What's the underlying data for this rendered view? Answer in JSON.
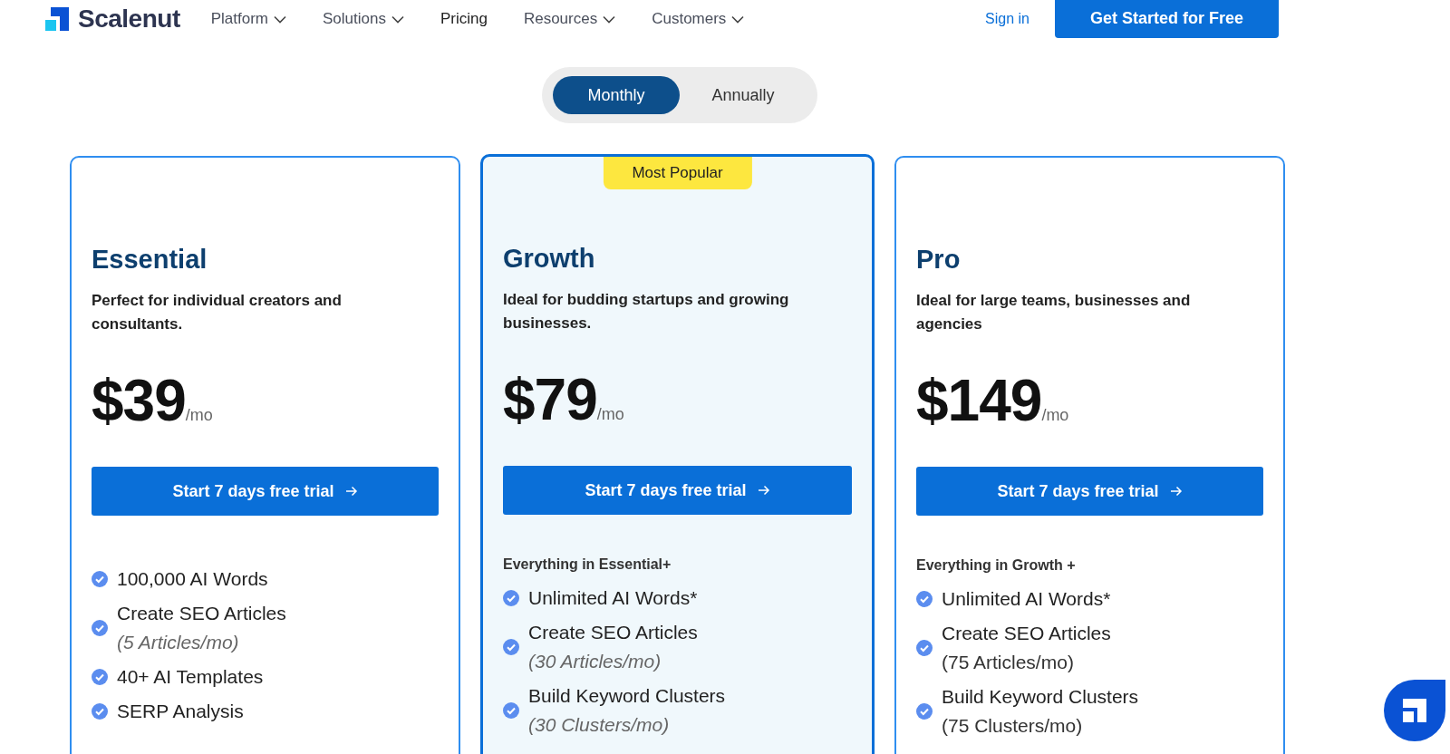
{
  "header": {
    "brand": "Scalenut",
    "nav": [
      {
        "label": "Platform",
        "dropdown": true
      },
      {
        "label": "Solutions",
        "dropdown": true
      },
      {
        "label": "Pricing",
        "dropdown": false
      },
      {
        "label": "Resources",
        "dropdown": true
      },
      {
        "label": "Customers",
        "dropdown": true
      }
    ],
    "sign_in": "Sign in",
    "cta": "Get Started for Free"
  },
  "billing_toggle": [
    {
      "label": "Monthly",
      "selected": true
    },
    {
      "label": "Annually",
      "selected": false
    }
  ],
  "plans": [
    {
      "name": "Essential",
      "featured": false,
      "description": "Perfect for individual creators and consultants.",
      "price": "$39",
      "period": "/mo",
      "button": "Start 7 days free trial",
      "notes_italic": true,
      "features": [
        {
          "text": "100,000 AI Words"
        },
        {
          "text": "Create SEO Articles",
          "note": "(5 Articles/mo)"
        },
        {
          "text": "40+ AI Templates"
        },
        {
          "text": "SERP Analysis"
        }
      ]
    },
    {
      "name": "Growth",
      "featured": true,
      "badge": "Most Popular",
      "description": "Ideal for budding startups and growing businesses.",
      "price": "$79",
      "period": "/mo",
      "button": "Start 7 days free trial",
      "intro": "Everything in Essential+",
      "notes_italic": true,
      "features": [
        {
          "text": "Unlimited AI Words*"
        },
        {
          "text": "Create SEO Articles",
          "note": "(30 Articles/mo)"
        },
        {
          "text": "Build Keyword Clusters",
          "note": "(30 Clusters/mo)"
        }
      ]
    },
    {
      "name": "Pro",
      "featured": false,
      "description": "Ideal for large teams, businesses and agencies",
      "price": "$149",
      "period": "/mo",
      "button": "Start 7 days free trial",
      "intro": "Everything in Growth +",
      "notes_italic": false,
      "features": [
        {
          "text": "Unlimited AI Words*"
        },
        {
          "text": "Create SEO Articles",
          "note": "(75 Articles/mo)"
        },
        {
          "text": "Build Keyword Clusters",
          "note": "(75 Clusters/mo)"
        }
      ]
    }
  ]
}
